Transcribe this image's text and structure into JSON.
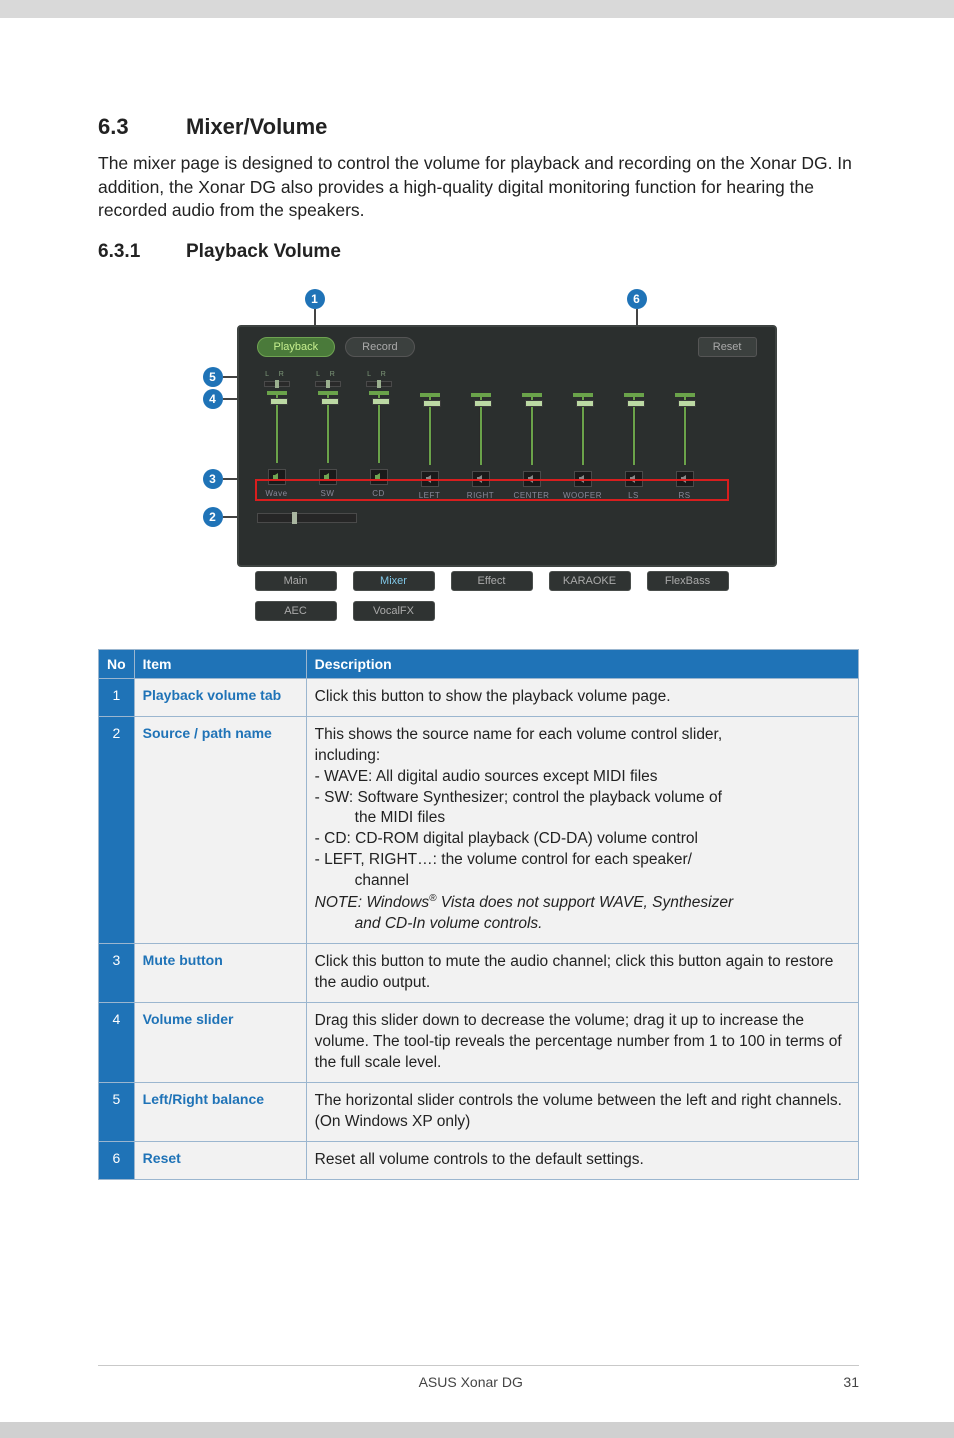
{
  "section": {
    "num": "6.3",
    "title": "Mixer/Volume"
  },
  "intro": "The mixer page is designed to control the volume for playback and recording on the Xonar DG. In addition, the Xonar DG also provides a high-quality digital monitoring function for hearing the recorded audio from the speakers.",
  "subsection": {
    "num": "6.3.1",
    "title": "Playback Volume"
  },
  "callouts": {
    "c1": "1",
    "c2": "2",
    "c3": "3",
    "c4": "4",
    "c5": "5",
    "c6": "6"
  },
  "mixer": {
    "playback_tab": "Playback",
    "record_tab": "Record",
    "reset": "Reset",
    "lr_label": "L    R",
    "sources": [
      "Wave",
      "SW",
      "CD",
      "LEFT",
      "RIGHT",
      "CENTER",
      "WOOFER",
      "LS",
      "RS"
    ],
    "bottom_tabs": [
      "Main",
      "Mixer",
      "Effect",
      "KARAOKE",
      "FlexBass",
      "AEC",
      "VocalFX"
    ]
  },
  "table": {
    "headers": {
      "no": "No",
      "item": "Item",
      "desc": "Description"
    },
    "rows": [
      {
        "no": "1",
        "item": "Playback volume tab",
        "desc": "Click this button to show the playback volume page."
      },
      {
        "no": "2",
        "item": "Source / path name",
        "desc_lines": [
          "This shows the source name for each volume control slider,",
          "including:",
          "- WAVE: All digital audio sources except MIDI files",
          "- SW: Software Synthesizer; control the playback volume of",
          "        the MIDI files",
          "- CD: CD-ROM digital playback (CD-DA) volume control",
          "- LEFT, RIGHT…: the volume control for each speaker/",
          "        channel"
        ],
        "note_prefix": "NOTE: Windows",
        "note_sup": "®",
        "note_rest": " Vista does not support WAVE, Synthesizer",
        "note_line2": "and CD-In volume controls."
      },
      {
        "no": "3",
        "item": "Mute button",
        "desc": "Click this button to mute the audio channel; click this button again to restore the audio output."
      },
      {
        "no": "4",
        "item": "Volume slider",
        "desc": "Drag this slider down to decrease the volume; drag it up to increase the volume. The tool-tip reveals the percentage number from 1 to 100 in terms of the full scale level."
      },
      {
        "no": "5",
        "item": "Left/Right balance",
        "desc": "The horizontal slider controls the volume between the left and right channels. (On Windows XP only)"
      },
      {
        "no": "6",
        "item": "Reset",
        "desc": "Reset all volume controls to the default settings."
      }
    ]
  },
  "footer": {
    "product": "ASUS Xonar DG",
    "page": "31"
  }
}
